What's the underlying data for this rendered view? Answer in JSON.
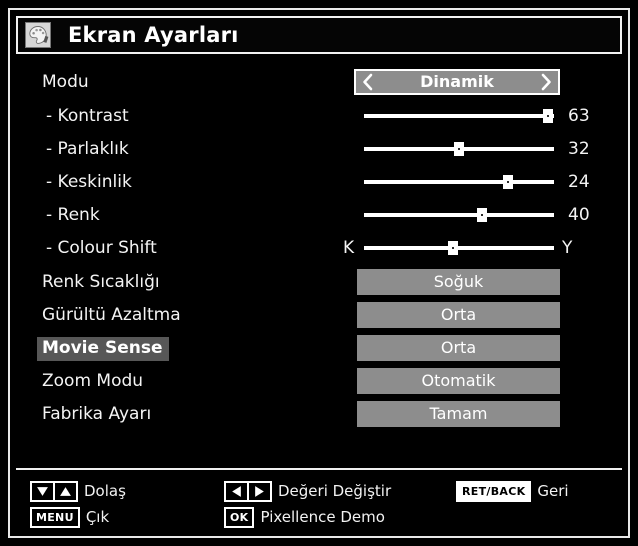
{
  "window": {
    "title": "Ekran Ayarları",
    "title_icon": "picture-settings-icon",
    "background": "#000000",
    "accent": "#8d8d8d"
  },
  "menu": {
    "rows": [
      {
        "label": "Modu",
        "type": "spinner",
        "value": "Dinamik",
        "left_icon": "chevron-left-icon",
        "right_icon": "chevron-right-icon",
        "selected": false,
        "name": "modu"
      },
      {
        "label": "- Kontrast",
        "type": "slider",
        "value": "63",
        "percent": 97,
        "selected": false,
        "name": "kontrast"
      },
      {
        "label": "- Parlaklık",
        "type": "slider",
        "value": "32",
        "percent": 50,
        "selected": false,
        "name": "parlaklik"
      },
      {
        "label": "- Keskinlik",
        "type": "slider",
        "value": "24",
        "percent": 76,
        "selected": false,
        "name": "keskinlik"
      },
      {
        "label": "- Renk",
        "type": "slider",
        "value": "40",
        "percent": 62,
        "selected": false,
        "name": "renk"
      },
      {
        "label": "- Colour Shift",
        "type": "slider-range",
        "left_cap": "K",
        "right_cap": "Y",
        "percent": 47,
        "selected": false,
        "name": "colour-shift"
      },
      {
        "label": "Renk Sıcaklığı",
        "type": "button",
        "value": "Soğuk",
        "selected": false,
        "name": "renk-sicakligi"
      },
      {
        "label": "Gürültü Azaltma",
        "type": "button",
        "value": "Orta",
        "selected": false,
        "name": "gurultu-azaltma"
      },
      {
        "label": "Movie Sense",
        "type": "button",
        "value": "Orta",
        "selected": true,
        "name": "movie-sense"
      },
      {
        "label": "Zoom Modu",
        "type": "button",
        "value": "Otomatik",
        "selected": false,
        "name": "zoom-modu"
      },
      {
        "label": "Fabrika Ayarı",
        "type": "button",
        "value": "Tamam",
        "selected": false,
        "name": "fabrika-ayari"
      }
    ]
  },
  "footer": {
    "hints": [
      {
        "key_type": "updown",
        "key_text": "",
        "label": "Dolaş",
        "name": "navigate-hint"
      },
      {
        "key_type": "text",
        "key_text": "MENU",
        "label": "Çık",
        "name": "exit-hint"
      },
      {
        "key_type": "leftright",
        "key_text": "",
        "label": "Değeri Değiştir",
        "name": "change-value-hint"
      },
      {
        "key_type": "text",
        "key_text": "OK",
        "label": "Pixellence Demo",
        "name": "pixellence-demo-hint"
      },
      {
        "key_type": "filled",
        "key_text": "RET/BACK",
        "label": "Geri",
        "name": "back-hint"
      }
    ]
  }
}
